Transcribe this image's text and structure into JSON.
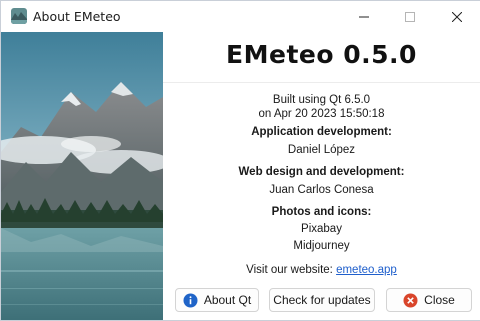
{
  "window": {
    "title": "About EMeteo"
  },
  "about": {
    "app_name": "EMeteo 0.5.0",
    "built_line": "Built using Qt 6.5.0",
    "date_line": "on Apr 20 2023 15:50:18",
    "app_dev_heading": "Application development:",
    "app_dev_name": "Daniel López",
    "web_heading": "Web design and development:",
    "web_name": "Juan Carlos Conesa",
    "photos_heading": "Photos and icons:",
    "photos_source_1": "Pixabay",
    "photos_source_2": "Midjourney",
    "website_prefix": "Visit our website:",
    "website_link": "emeteo.app"
  },
  "buttons": {
    "about_qt": "About Qt",
    "check_updates": "Check for updates",
    "close": "Close"
  },
  "icons": {
    "app": "app-icon",
    "info": "info-icon",
    "close": "close-circle-icon"
  },
  "colors": {
    "link": "#1f5fcc",
    "info_icon": "#1f64c8",
    "close_icon": "#d9452b"
  }
}
